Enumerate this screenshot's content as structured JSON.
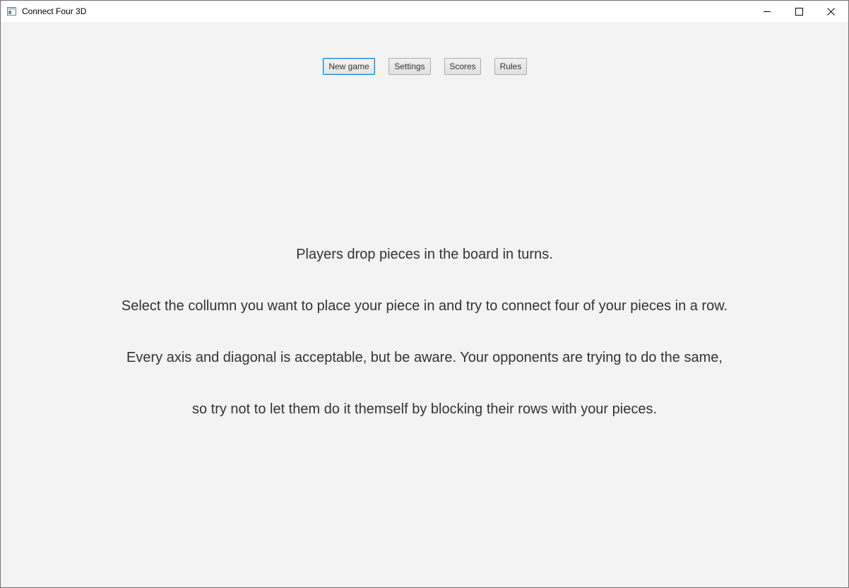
{
  "window": {
    "title": "Connect Four 3D",
    "app_icon": "app-window-icon",
    "controls": {
      "minimize_icon": "minimize-icon",
      "maximize_icon": "maximize-icon",
      "close_icon": "close-icon"
    }
  },
  "menu": {
    "new_game_label": "New game",
    "settings_label": "Settings",
    "scores_label": "Scores",
    "rules_label": "Rules",
    "focused": "New game"
  },
  "rules": {
    "lines": [
      "Players drop pieces in the board in turns.",
      "Select the collumn you want to place your piece in and try to connect four of your pieces in a row.",
      "Every axis and diagonal is acceptable, but be aware. Your opponents are trying to do the same,",
      "so try not to let them do it themself by blocking their rows with your pieces."
    ]
  },
  "colors": {
    "background": "#f3f3f3",
    "titlebar": "#ffffff",
    "text": "#333333",
    "focus_border": "#0a84d8"
  }
}
